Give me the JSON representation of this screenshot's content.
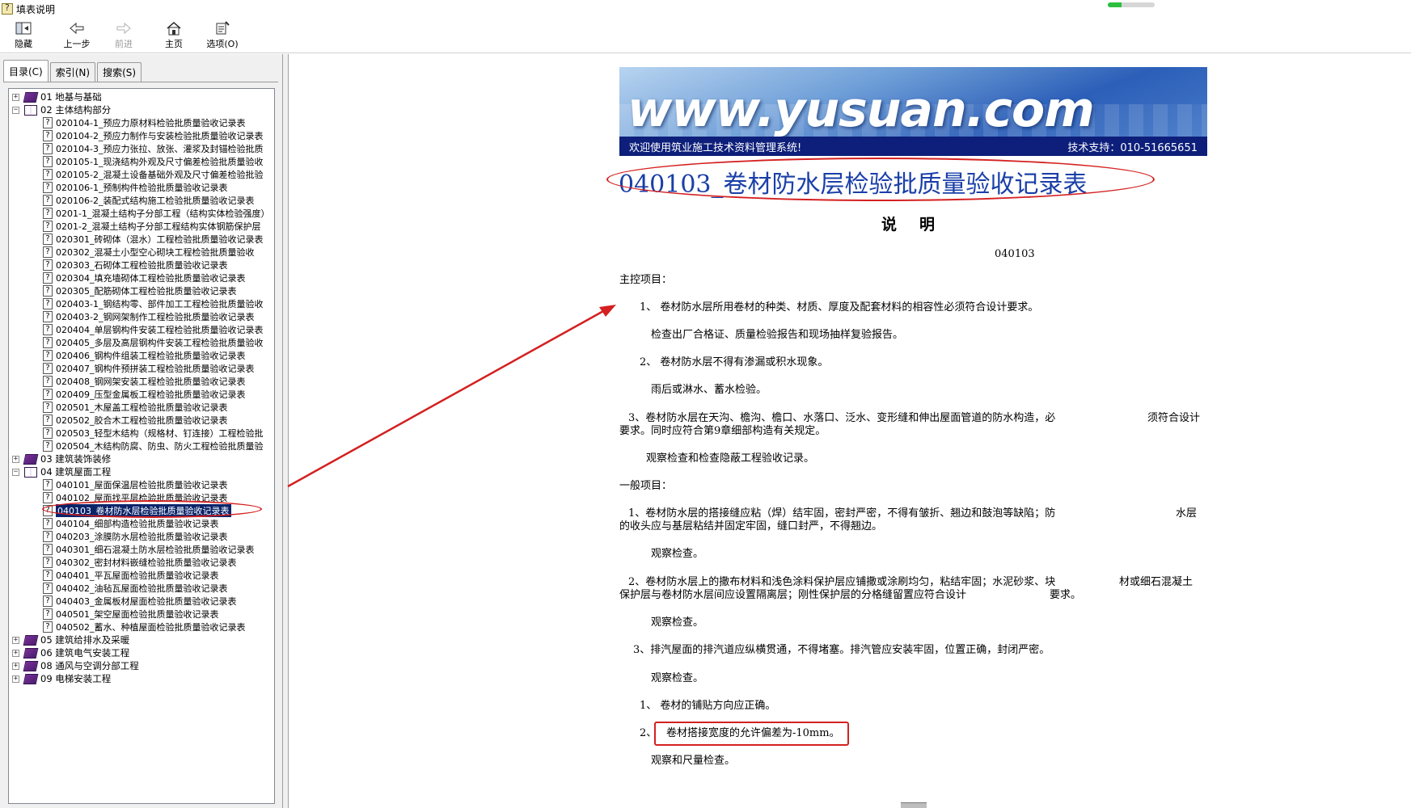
{
  "window": {
    "title": "填表说明",
    "loading_progress": 0.3
  },
  "toolbar": {
    "buttons": [
      {
        "label": "隐藏",
        "icon": "hide-icon",
        "enabled": true
      },
      {
        "label": "上一步",
        "icon": "back-arrow-icon",
        "enabled": true
      },
      {
        "label": "前进",
        "icon": "forward-arrow-icon",
        "enabled": false
      },
      {
        "label": "主页",
        "icon": "home-icon",
        "enabled": true
      },
      {
        "label": "选项(O)",
        "icon": "options-icon",
        "enabled": true
      }
    ]
  },
  "nav_tabs": [
    {
      "label": "目录(C)",
      "active": true
    },
    {
      "label": "索引(N)",
      "active": false
    },
    {
      "label": "搜索(S)",
      "active": false
    }
  ],
  "tree": [
    {
      "type": "book",
      "expanded": false,
      "label": "01 地基与基础"
    },
    {
      "type": "book",
      "expanded": true,
      "label": "02 主体结构部分"
    },
    {
      "type": "page",
      "label": "020104-1_预应力原材料检验批质量验收记录表"
    },
    {
      "type": "page",
      "label": "020104-2_预应力制作与安装检验批质量验收记录表"
    },
    {
      "type": "page",
      "label": "020104-3_预应力张拉、放张、灌浆及封锚检验批质"
    },
    {
      "type": "page",
      "label": "020105-1_现浇结构外观及尺寸偏差检验批质量验收"
    },
    {
      "type": "page",
      "label": "020105-2_混凝土设备基础外观及尺寸偏差检验批验"
    },
    {
      "type": "page",
      "label": "020106-1_预制构件检验批质量验收记录表"
    },
    {
      "type": "page",
      "label": "020106-2_装配式结构施工检验批质量验收记录表"
    },
    {
      "type": "page",
      "label": "0201-1_混凝土结构子分部工程（结构实体检验强度）"
    },
    {
      "type": "page",
      "label": "0201-2_混凝土结构子分部工程结构实体钢筋保护层"
    },
    {
      "type": "page",
      "label": "020301_砖砌体（混水）工程检验批质量验收记录表"
    },
    {
      "type": "page",
      "label": "020302_混凝土小型空心砌块工程检验批质量验收"
    },
    {
      "type": "page",
      "label": "020303_石砌体工程检验批质量验收记录表"
    },
    {
      "type": "page",
      "label": "020304_填充墙砌体工程检验批质量验收记录表"
    },
    {
      "type": "page",
      "label": "020305_配筋砌体工程检验批质量验收记录表"
    },
    {
      "type": "page",
      "label": "020403-1_钢结构零、部件加工工程检验批质量验收"
    },
    {
      "type": "page",
      "label": "020403-2_钢网架制作工程检验批质量验收记录表"
    },
    {
      "type": "page",
      "label": "020404_单层钢构件安装工程检验批质量验收记录表"
    },
    {
      "type": "page",
      "label": "020405_多层及高层钢构件安装工程检验批质量验收"
    },
    {
      "type": "page",
      "label": "020406_钢构件组装工程检验批质量验收记录表"
    },
    {
      "type": "page",
      "label": "020407_钢构件预拼装工程检验批质量验收记录表"
    },
    {
      "type": "page",
      "label": "020408_钢网架安装工程检验批质量验收记录表"
    },
    {
      "type": "page",
      "label": "020409_压型金属板工程检验批质量验收记录表"
    },
    {
      "type": "page",
      "label": "020501_木屋盖工程检验批质量验收记录表"
    },
    {
      "type": "page",
      "label": "020502_胶合木工程检验批质量验收记录表"
    },
    {
      "type": "page",
      "label": "020503_轻型木结构（规格材、钉连接）工程检验批"
    },
    {
      "type": "page",
      "label": "020504_木结构防腐、防虫、防火工程检验批质量验"
    },
    {
      "type": "book",
      "expanded": false,
      "label": "03 建筑装饰装修"
    },
    {
      "type": "book",
      "expanded": true,
      "label": "04 建筑屋面工程"
    },
    {
      "type": "page",
      "label": "040101_屋面保温层检验批质量验收记录表"
    },
    {
      "type": "page",
      "label": "040102_屋面找平层检验批质量验收记录表"
    },
    {
      "type": "page",
      "label": "040103_卷材防水层检验批质量验收记录表",
      "selected": true
    },
    {
      "type": "page",
      "label": "040104_细部构造检验批质量验收记录表"
    },
    {
      "type": "page",
      "label": "040203_涂膜防水层检验批质量验收记录表"
    },
    {
      "type": "page",
      "label": "040301_细石混凝土防水层检验批质量验收记录表"
    },
    {
      "type": "page",
      "label": "040302_密封材料嵌缝检验批质量验收记录表"
    },
    {
      "type": "page",
      "label": "040401_平瓦屋面检验批质量验收记录表"
    },
    {
      "type": "page",
      "label": "040402_油毡瓦屋面检验批质量验收记录表"
    },
    {
      "type": "page",
      "label": "040403_金属板材屋面检验批质量验收记录表"
    },
    {
      "type": "page",
      "label": "040501_架空屋面检验批质量验收记录表"
    },
    {
      "type": "page",
      "label": "040502_蓄水、种植屋面检验批质量验收记录表"
    },
    {
      "type": "book",
      "expanded": false,
      "label": "05 建筑给排水及采暖"
    },
    {
      "type": "book",
      "expanded": false,
      "label": "06 建筑电气安装工程"
    },
    {
      "type": "book",
      "expanded": false,
      "label": "08 通风与空调分部工程"
    },
    {
      "type": "book",
      "expanded": false,
      "label": "09 电梯安装工程"
    }
  ],
  "banner": {
    "logo_text": "www.yusuan.com",
    "welcome": "欢迎使用筑业施工技术资料管理系统!",
    "support": "技术支持：010-51665651"
  },
  "document": {
    "title": "040103_卷材防水层检验批质量验收记录表",
    "subtitle": "说明",
    "code": "040103",
    "main_items_heading": "主控项目：",
    "main_1": "1、 卷材防水层所用卷材的种类、材质、厚度及配套材料的相容性必须符合设计要求。",
    "main_1_check": "检查出厂合格证、质量检验报告和现场抽样复验报告。",
    "main_2": "2、 卷材防水层不得有渗漏或积水现象。",
    "main_2_check": "雨后或淋水、蓄水检验。",
    "main_3_a": "3、卷材防水层在天沟、檐沟、檐口、水落口、泛水、变形缝和伸出屋面管道的防水构造，必",
    "main_3_b": "须符合设计",
    "main_3_c": "要求。同时应符合第9章细部构造有关规定。",
    "main_3_check": "观察检查和检查隐蔽工程验收记录。",
    "general_heading": "一般项目：",
    "gen_1_a": "1、卷材防水层的搭接缝应粘（焊）结牢固，密封严密，不得有皱折、翘边和鼓泡等缺陷；防",
    "gen_1_b": "水层",
    "gen_1_c": "的收头应与基层粘结并固定牢固，缝口封严，不得翘边。",
    "gen_1_check": "观察检查。",
    "gen_2_a": "2、卷材防水层上的撒布材料和浅色涂料保护层应铺撒或涂刷均匀，粘结牢固；水泥砂浆、块",
    "gen_2_b": "材或细石混凝土",
    "gen_2_c": "保护层与卷材防水层间应设置隔离层；刚性保护层的分格缝留置应符合设计",
    "gen_2_d": "要求。",
    "gen_2_check": "观察检查。",
    "gen_3": "3、排汽屋面的排汽道应纵横贯通，不得堵塞。排汽管应安装牢固，位置正确，封闭严密。",
    "gen_3_check": "观察检查。",
    "gen_4": "1、 卷材的铺贴方向应正确。",
    "gen_5_num": "2、",
    "gen_5": "卷材搭接宽度的允许偏差为-10mm。",
    "gen_5_check": "观察和尺量检查。"
  },
  "annotation_colors": {
    "highlight_red": "#d42020",
    "title_blue": "#1a3fa8",
    "selection_blue": "#0a246a"
  }
}
